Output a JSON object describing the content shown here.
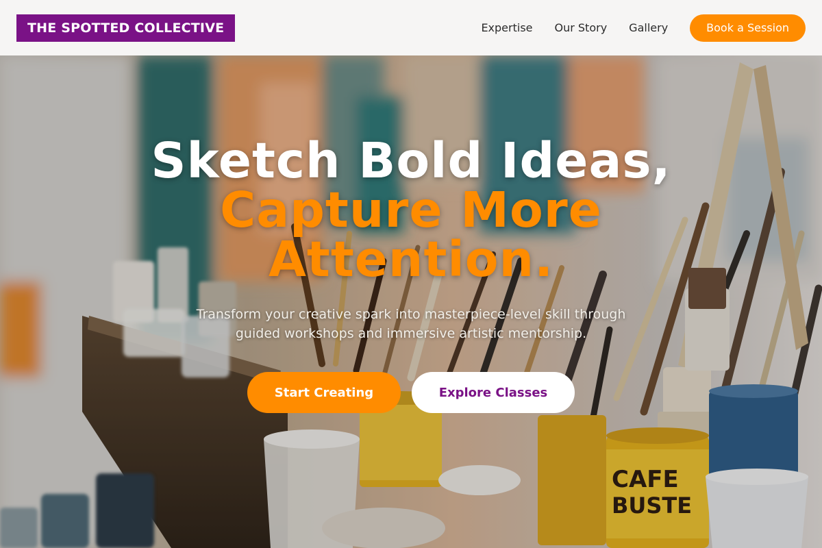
{
  "brand": {
    "name": "THE SPOTTED COLLECTIVE",
    "color": "#7a1286"
  },
  "nav": {
    "items": [
      {
        "label": "Expertise"
      },
      {
        "label": "Our Story"
      },
      {
        "label": "Gallery"
      }
    ],
    "cta_label": "Book a Session"
  },
  "hero": {
    "headline_line1": "Sketch Bold Ideas,",
    "headline_line2": "Capture More Attention.",
    "subtitle": "Transform your creative spark into masterpiece-level skill through guided workshops and immersive artistic mentorship.",
    "primary_cta": "Start Creating",
    "secondary_cta": "Explore Classes",
    "background_image": "art studio with paint cans and brushes"
  },
  "colors": {
    "accent": "#ff8c00",
    "brand": "#7a1286",
    "header_bg": "#f6f5f4"
  }
}
